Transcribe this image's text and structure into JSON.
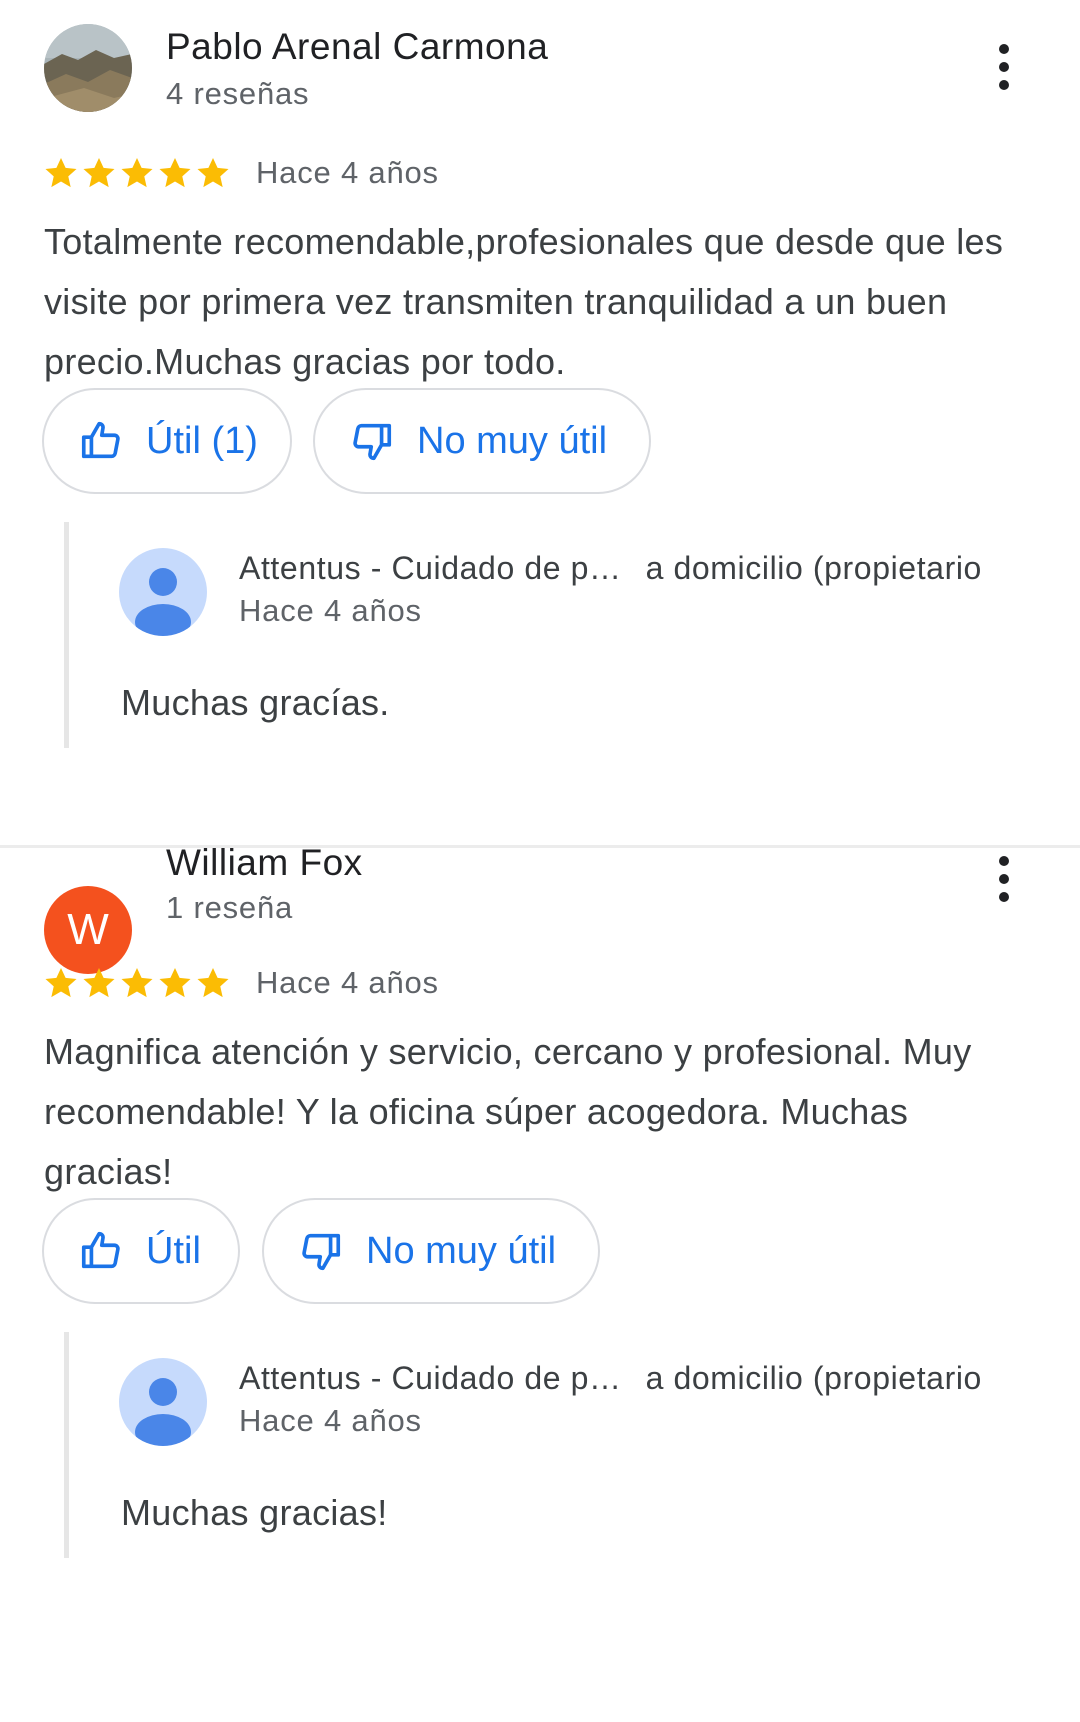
{
  "reviews": [
    {
      "author_name": "Pablo Arenal Carmona",
      "author_review_count": "4 reseñas",
      "avatar_type": "photo",
      "rating": 5,
      "date": "Hace 4 años",
      "text": "Totalmente recomendable,profesionales que desde que les visite por primera vez transmiten tranquilidad a un buen precio.Muchas gracias por todo.",
      "helpful_label": "Útil (1)",
      "not_helpful_label": "No muy útil",
      "owner_reply": {
        "owner_name": "Attentus - Cuidado de p…",
        "owner_role": "a domicilio (propietario",
        "date": "Hace 4 años",
        "text": "Muchas gracías."
      }
    },
    {
      "author_name": "William Fox",
      "author_review_count": "1 reseña",
      "avatar_type": "letter",
      "avatar_letter": "W",
      "avatar_color": "#f4511e",
      "rating": 5,
      "date": "Hace 4 años",
      "text": "Magnifica atención y servicio, cercano y profesional. Muy recomendable! Y la oficina súper acogedora. Muchas gracias!",
      "helpful_label": "Útil",
      "not_helpful_label": "No muy útil",
      "owner_reply": {
        "owner_name": "Attentus - Cuidado de p…",
        "owner_role": "a domicilio (propietario",
        "date": "Hace 4 años",
        "text": "Muchas gracias!"
      }
    }
  ],
  "colors": {
    "star": "#fbbc04",
    "accent": "#1a73e8",
    "owner_avatar_bg": "#c6dafc",
    "owner_avatar_fg": "#4a86e8"
  },
  "icons": {
    "more": "more-vert-icon",
    "thumbs_up": "thumb-up-icon",
    "thumbs_down": "thumb-down-icon",
    "star": "star-icon",
    "person": "person-icon"
  }
}
